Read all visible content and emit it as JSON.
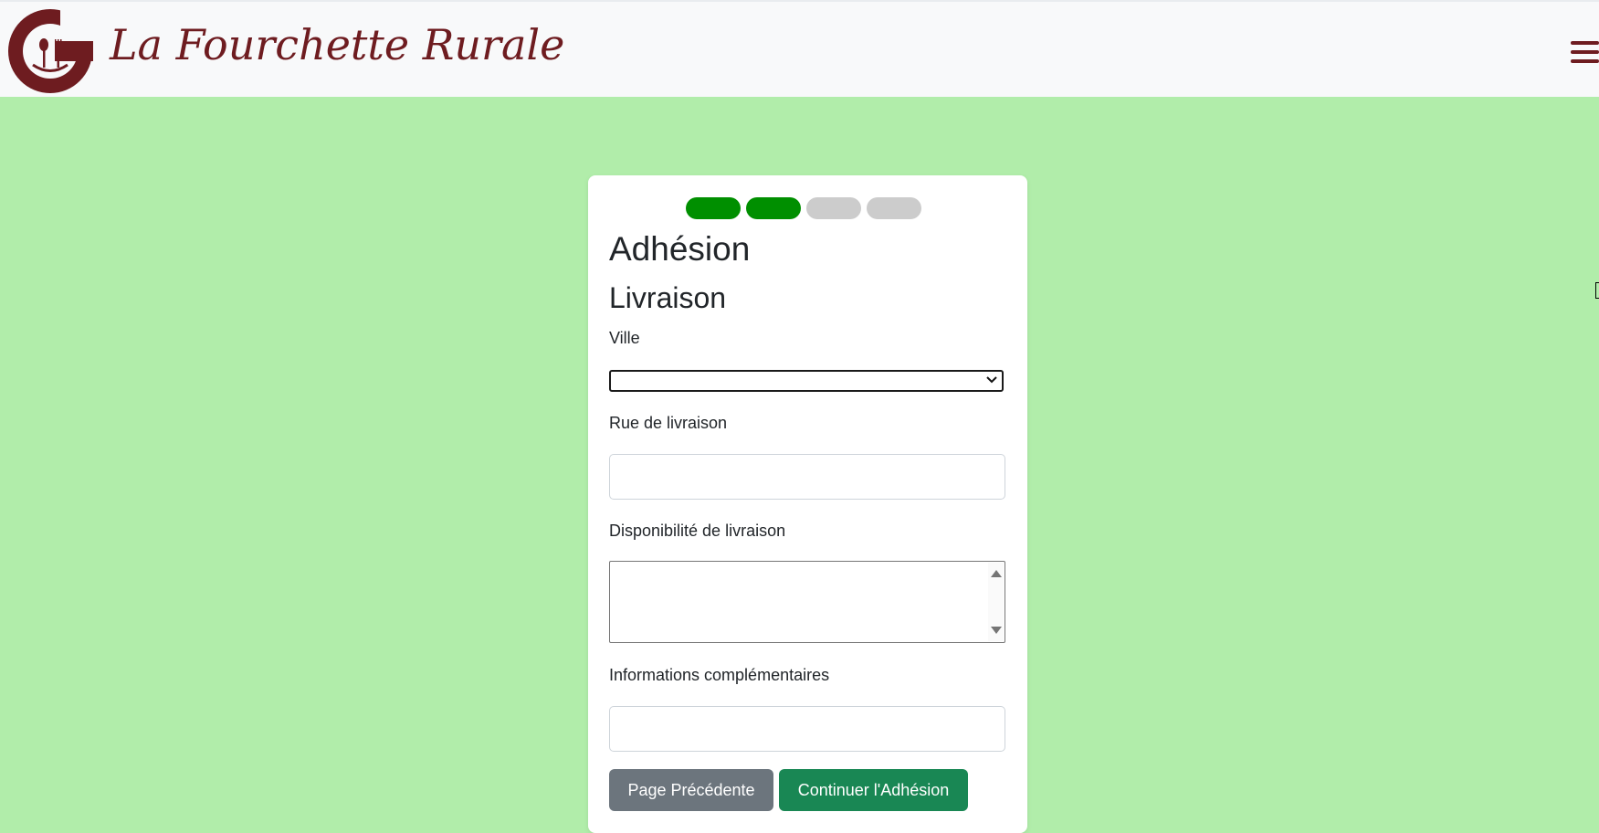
{
  "header": {
    "brand": "La Fourchette Rurale",
    "logo_letter": "C",
    "menu_icon": "hamburger-icon"
  },
  "colors": {
    "brand": "#6e1c20",
    "page_bg": "#b1edaa",
    "step_done": "#008f00",
    "step_todo": "#cccccc",
    "primary_button": "#198754",
    "secondary_button": "#6c757d"
  },
  "progress": {
    "total_steps": 4,
    "completed_steps": 2
  },
  "form": {
    "title": "Adhésion",
    "section": "Livraison",
    "ville_label": "Ville",
    "ville_value": "",
    "rue_label": "Rue de livraison",
    "rue_value": "",
    "disponibilite_label": "Disponibilité de livraison",
    "disponibilite_value": "",
    "infos_label": "Informations complémentaires",
    "infos_value": "",
    "prev_button": "Page Précédente",
    "next_button": "Continuer l'Adhésion"
  }
}
